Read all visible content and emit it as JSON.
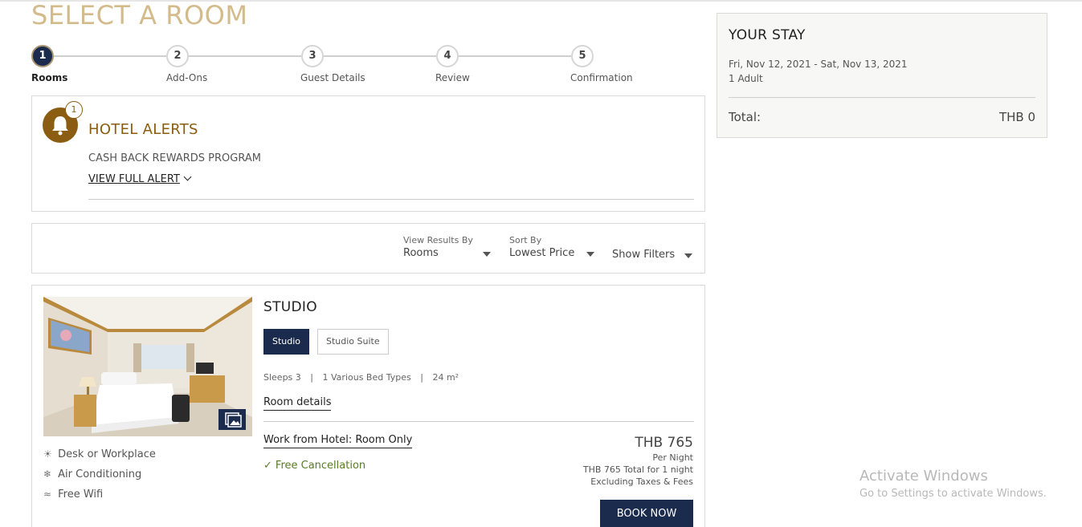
{
  "page": {
    "title": "SELECT A ROOM"
  },
  "stepper": {
    "steps": [
      {
        "number": "1",
        "label": "Rooms"
      },
      {
        "number": "2",
        "label": "Add-Ons"
      },
      {
        "number": "3",
        "label": "Guest Details"
      },
      {
        "number": "4",
        "label": "Review"
      },
      {
        "number": "5",
        "label": "Confirmation"
      }
    ]
  },
  "alerts": {
    "title": "HOTEL ALERTS",
    "count": "1",
    "item": "CASH BACK REWARDS PROGRAM",
    "view_full": "VIEW FULL ALERT"
  },
  "filters": {
    "view_results_label": "View Results By",
    "view_results_value": "Rooms",
    "sort_label": "Sort By",
    "sort_value": "Lowest Price",
    "show_filters": "Show Filters"
  },
  "room": {
    "title": "STUDIO",
    "tabs": [
      "Studio",
      "Studio Suite"
    ],
    "sleeps": "Sleeps 3",
    "beds": "1 Various Bed Types",
    "size": "24 m²",
    "details_link": "Room details",
    "amenities": [
      "Desk or Workplace",
      "Air Conditioning",
      "Free Wifi"
    ],
    "rate_name": "Work from Hotel: Room Only",
    "cancellation": "Free Cancellation",
    "price": "THB 765",
    "per_night": "Per Night",
    "total_line": "THB 765 Total for 1 night",
    "taxes_line": "Excluding Taxes & Fees",
    "book_label": "BOOK NOW"
  },
  "stay": {
    "title": "YOUR STAY",
    "dates": "Fri, Nov 12, 2021 - Sat, Nov 13, 2021",
    "guests": "1 Adult",
    "total_label": "Total:",
    "total_value": "THB 0"
  },
  "watermark": {
    "title": "Activate Windows",
    "subtitle": "Go to Settings to activate Windows."
  },
  "colors": {
    "navy": "#1b2b4e",
    "gold_title": "#d4bb8c",
    "alert_brown": "#8a5d12",
    "green": "#5a7a27"
  }
}
